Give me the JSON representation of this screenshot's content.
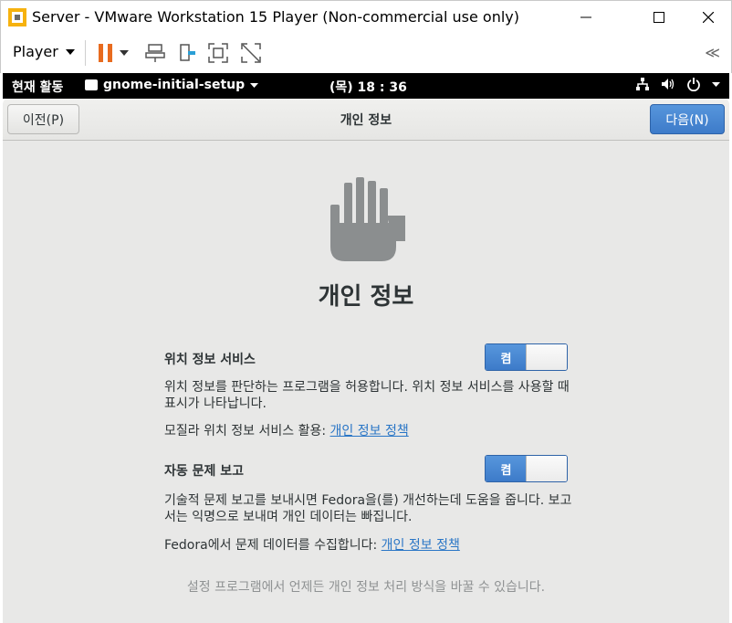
{
  "window": {
    "title": "Server - VMware Workstation 15 Player (Non-commercial use only)"
  },
  "toolbar": {
    "player_label": "Player",
    "collapse_glyph": "≪",
    "accent_color": "#e86b1f"
  },
  "gnome_bar": {
    "activities": "현재 활동",
    "app_name": "gnome-initial-setup",
    "clock": "(목) 18 : 36"
  },
  "header": {
    "prev_label": "이전(P)",
    "title": "개인 정보",
    "next_label": "다음(N)"
  },
  "main": {
    "heading": "개인 정보",
    "location": {
      "title": "위치 정보 서비스",
      "toggle_label": "켬",
      "description": "위치 정보를 판단하는 프로그램을 허용합니다. 위치 정보 서비스를 사용할 때 표시가 나타납니다.",
      "policy_prefix": "모질라 위치 정보 서비스 활용: ",
      "policy_link": "개인 정보 정책"
    },
    "problem_reporting": {
      "title": "자동 문제 보고",
      "toggle_label": "켬",
      "description": "기술적 문제 보고를 보내시면 Fedora을(를) 개선하는데 도움을 줍니다. 보고서는 익명으로 보내며 개인 데이터는 빠집니다.",
      "policy_prefix": "Fedora에서 문제 데이터를 수집합니다: ",
      "policy_link": "개인 정보 정책"
    },
    "footer": "설정 프로그램에서 언제든 개인 정보 처리 방식을 바꿀 수 있습니다."
  }
}
